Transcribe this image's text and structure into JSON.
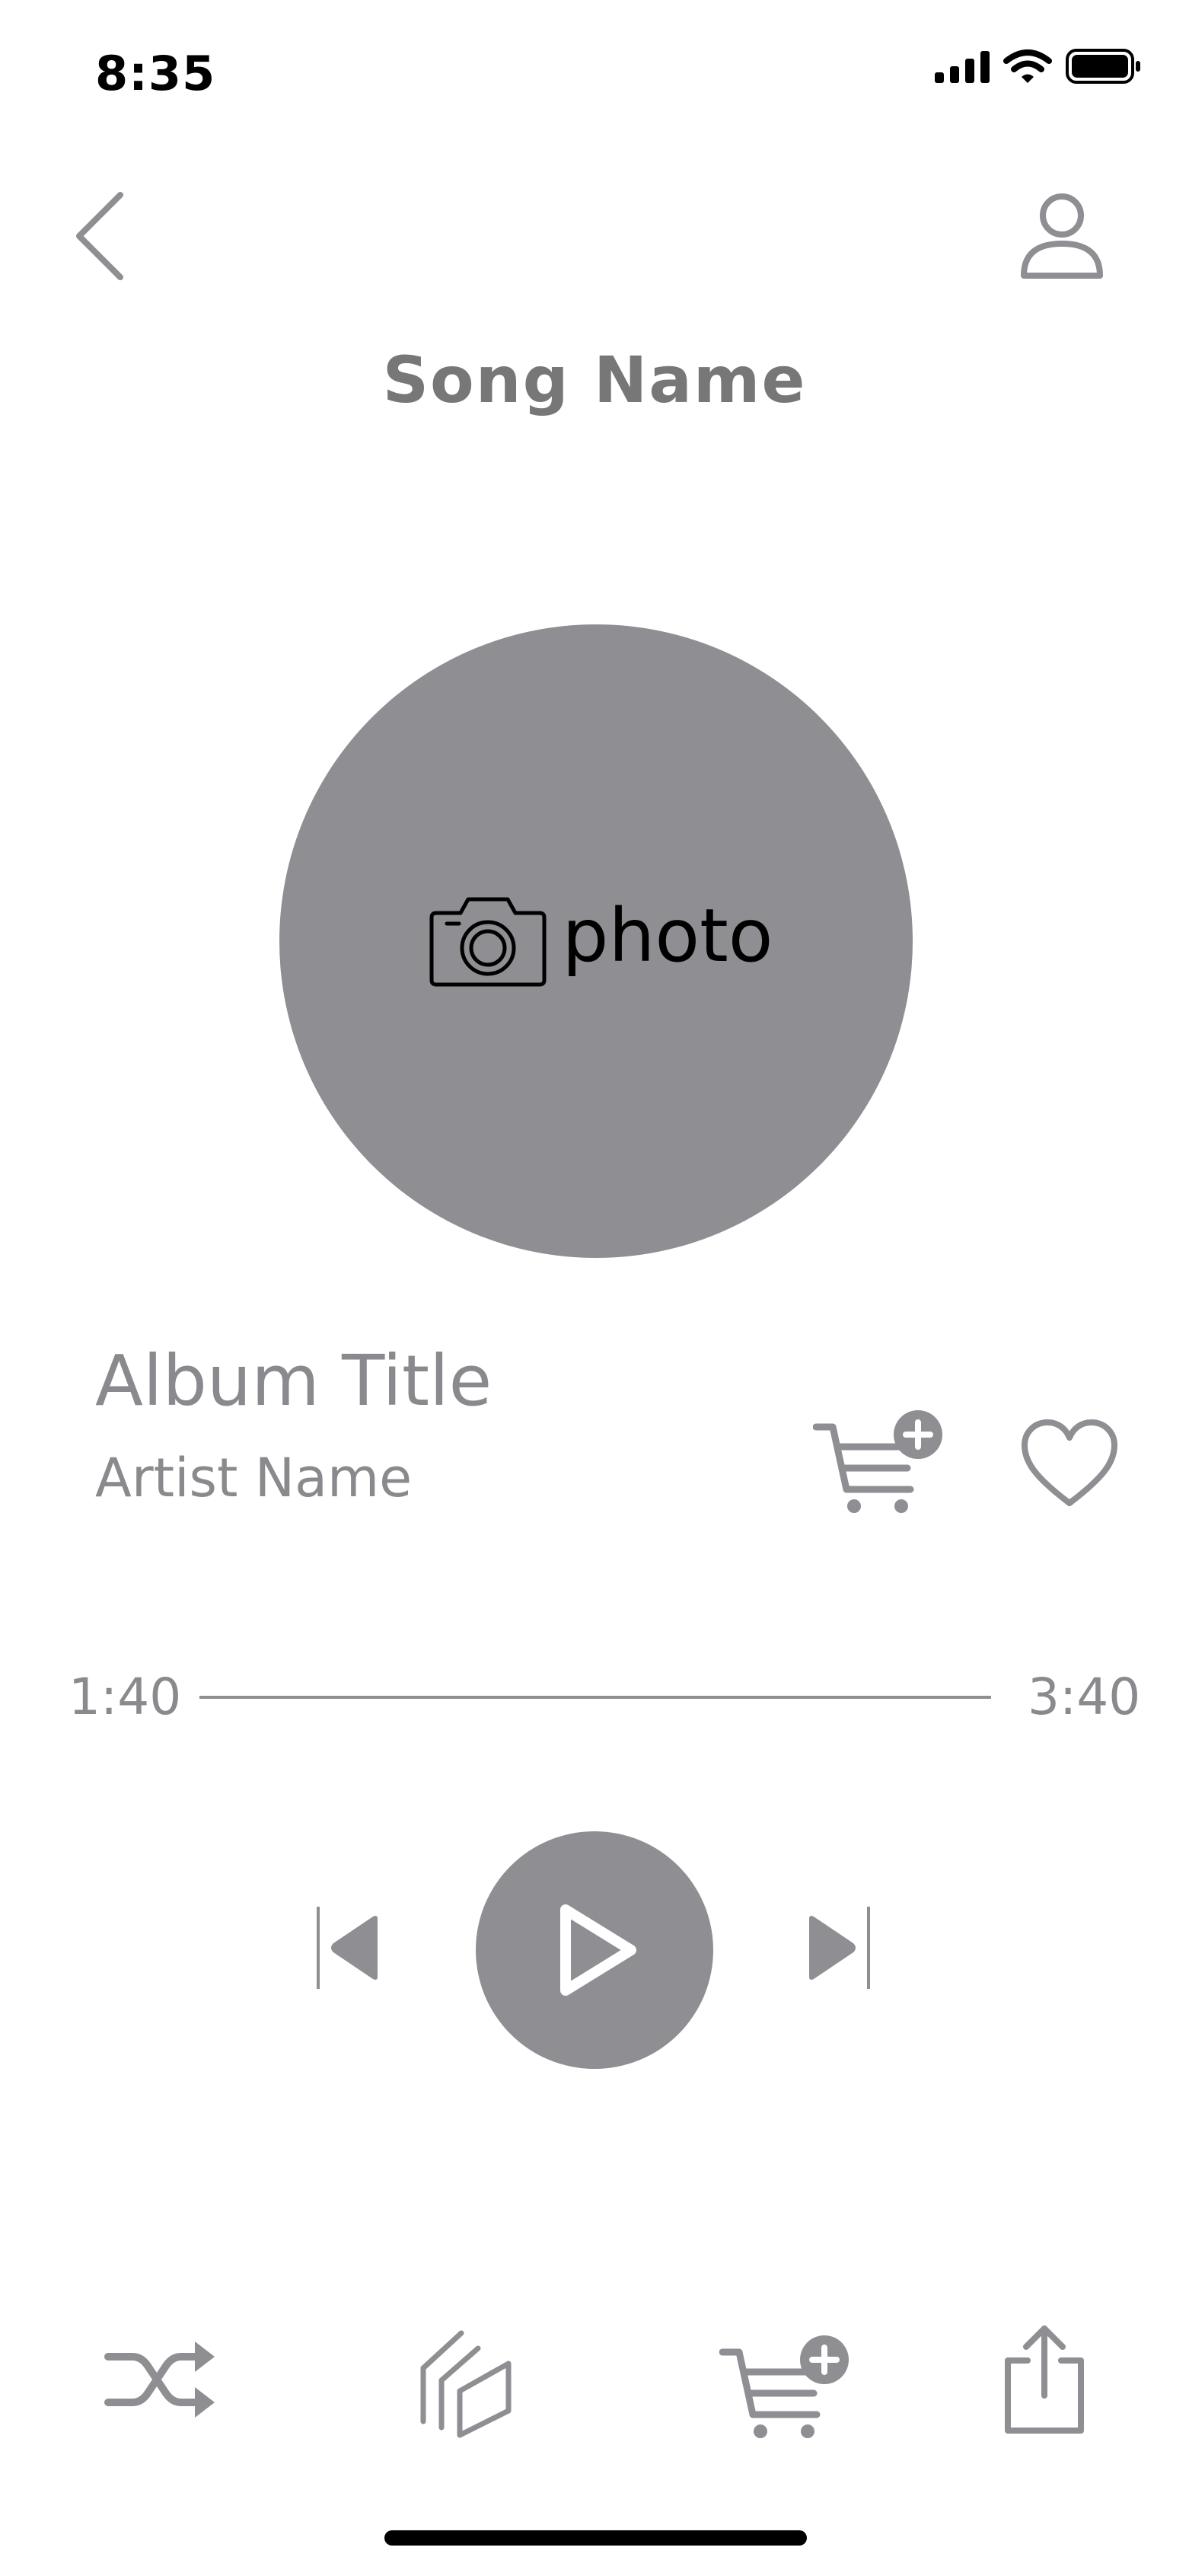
{
  "status_bar": {
    "time": "8:35"
  },
  "header": {
    "title": "Song Name"
  },
  "album_art": {
    "photo_label": "photo"
  },
  "track": {
    "album_title": "Album Title",
    "artist_name": "Artist Name"
  },
  "progress": {
    "current": "1:40",
    "total": "3:40"
  },
  "icons": {
    "back": "back-chevron-icon",
    "profile": "profile-icon",
    "add_to_cart": "cart-plus-icon",
    "favorite": "heart-icon",
    "previous": "skip-previous-icon",
    "play": "play-icon",
    "next": "skip-next-icon",
    "shuffle": "shuffle-icon",
    "library": "library-icon",
    "share": "share-icon",
    "camera": "camera-icon"
  },
  "colors": {
    "gray": "#8e8e93",
    "text_gray": "#8a8a8e",
    "background": "#ffffff"
  }
}
